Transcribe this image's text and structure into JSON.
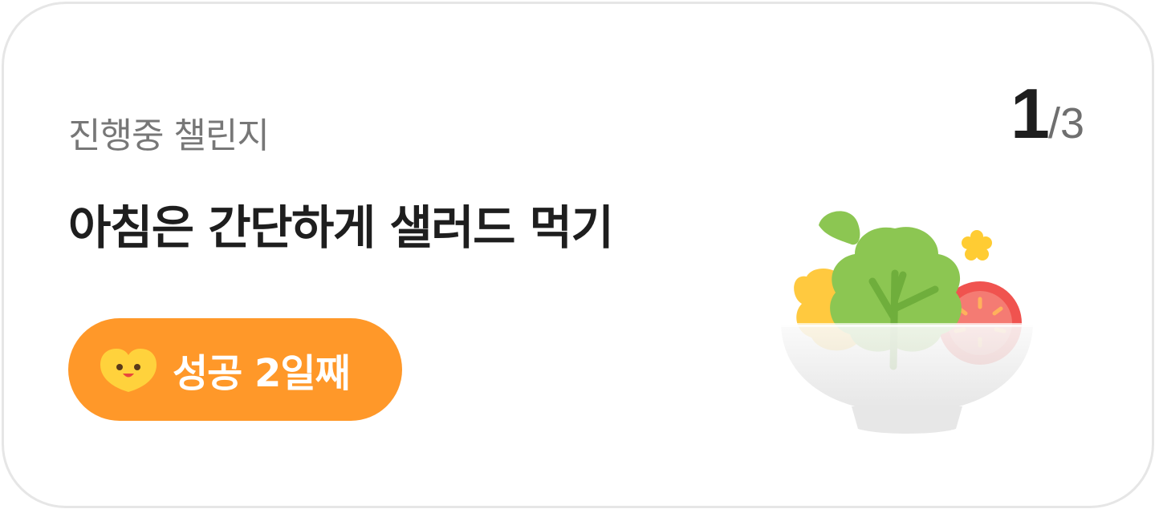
{
  "card": {
    "subtitle": "진행중 챌린지",
    "title": "아침은 간단하게 샐러드 먹기",
    "counter": {
      "current": "1",
      "separator": "/",
      "total": "3"
    },
    "badge": {
      "label": "성공 2일째",
      "icon": "smiley-heart-icon",
      "color": "#ff9829"
    },
    "illustration": "salad-bowl-icon"
  }
}
